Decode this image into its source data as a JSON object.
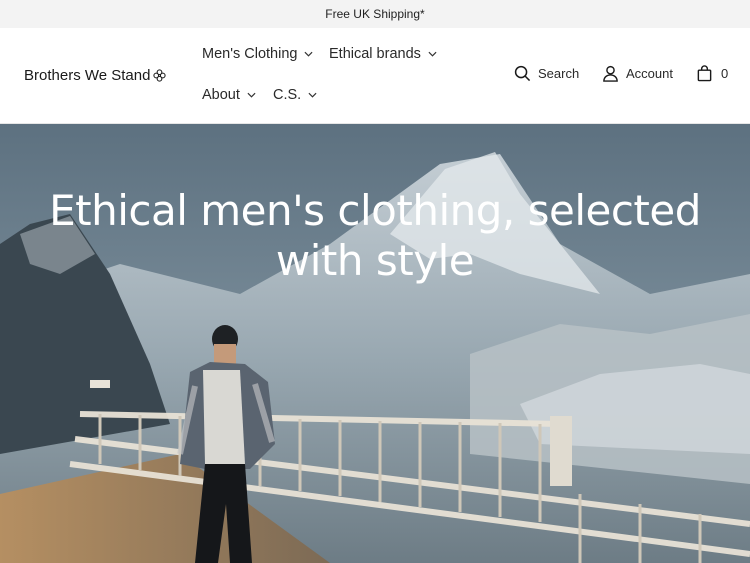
{
  "announcement": {
    "text": "Free UK Shipping*"
  },
  "header": {
    "logo_text": "Brothers We Stand",
    "nav": [
      {
        "label": "Men's Clothing"
      },
      {
        "label": "Ethical brands"
      },
      {
        "label": "About"
      },
      {
        "label": "C.S."
      }
    ],
    "tools": {
      "search_label": "Search",
      "account_label": "Account",
      "cart_count": "0"
    }
  },
  "hero": {
    "title_line1": "Ethical men's clothing, selected",
    "title_line2": "with style"
  },
  "colors": {
    "announcement_bg": "#f3f3f3",
    "text": "#1a1a1a",
    "hero_text": "#ffffff"
  }
}
